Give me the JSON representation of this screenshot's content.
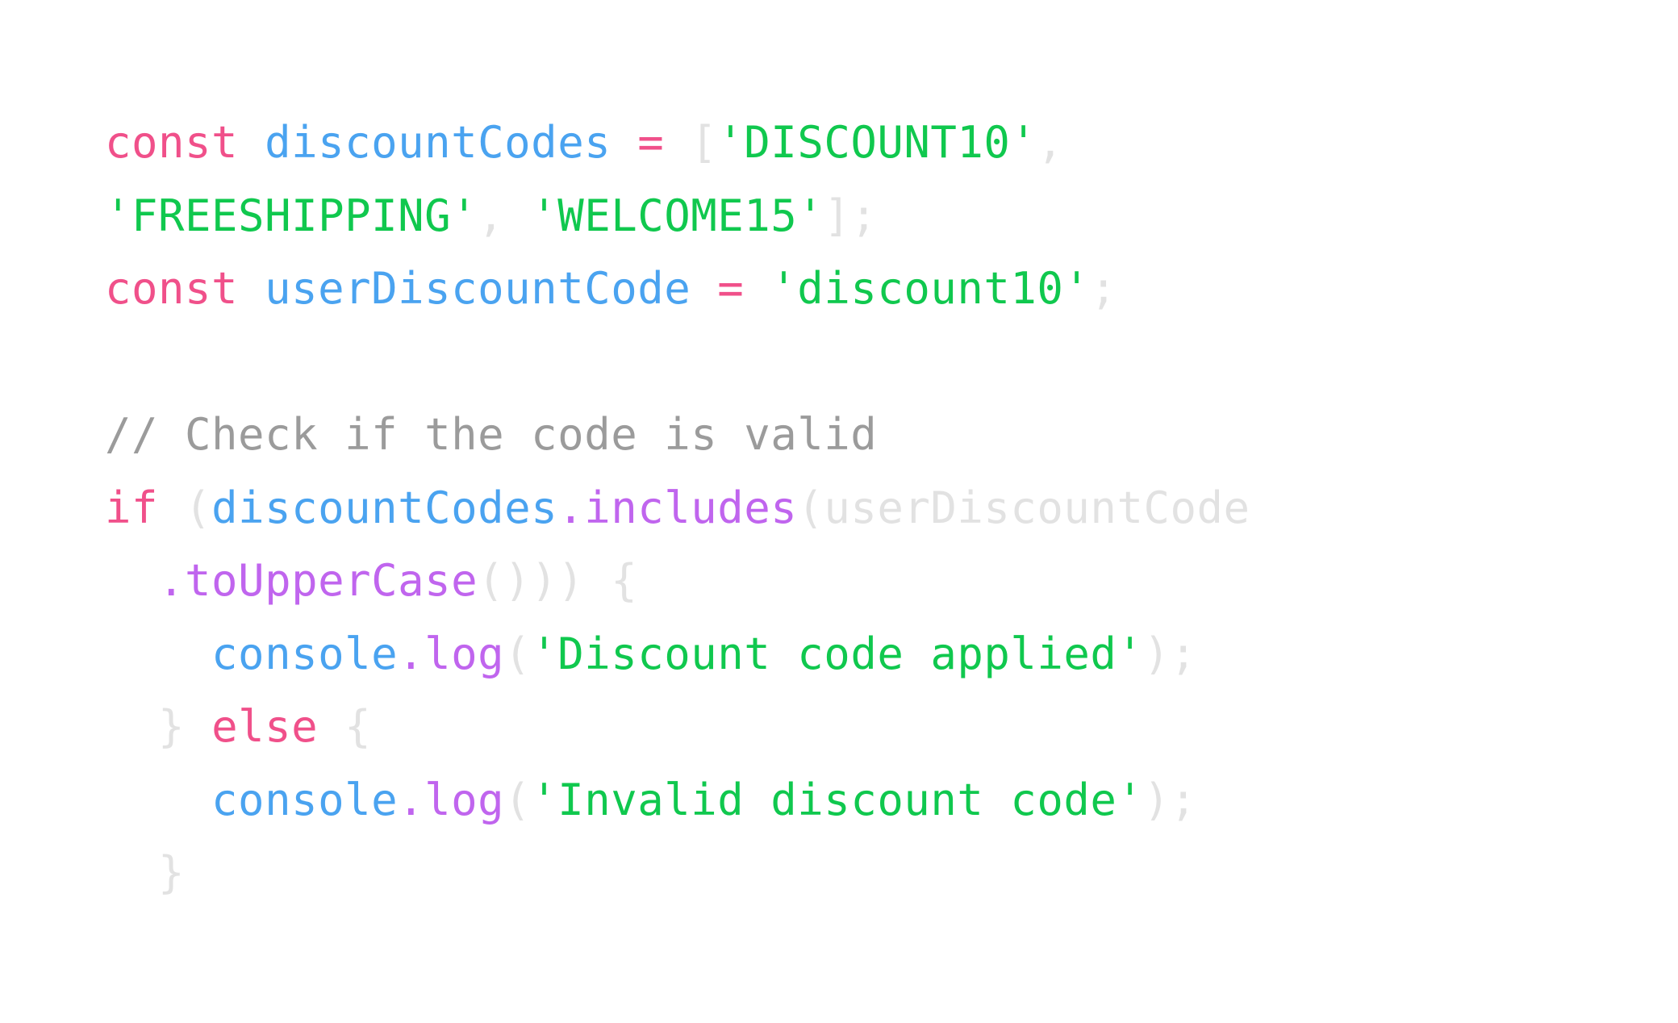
{
  "theme": {
    "keyword": "#f0508a",
    "identifier": "#4aa3f0",
    "method": "#c065ee",
    "string": "#10c84e",
    "punct": "#e2e2e2",
    "comment": "#9b9b9b",
    "background": "#ffffff"
  },
  "code": {
    "lines": [
      [
        {
          "t": "const",
          "k": "keyword"
        },
        {
          "t": " ",
          "k": "plain"
        },
        {
          "t": "discountCodes",
          "k": "identifier"
        },
        {
          "t": " ",
          "k": "plain"
        },
        {
          "t": "=",
          "k": "keyword"
        },
        {
          "t": " ",
          "k": "plain"
        },
        {
          "t": "[",
          "k": "punct"
        },
        {
          "t": "'DISCOUNT10'",
          "k": "string"
        },
        {
          "t": ",",
          "k": "punct"
        }
      ],
      [
        {
          "t": "'FREESHIPPING'",
          "k": "string"
        },
        {
          "t": ", ",
          "k": "punct"
        },
        {
          "t": "'WELCOME15'",
          "k": "string"
        },
        {
          "t": "];",
          "k": "punct"
        }
      ],
      [
        {
          "t": "const",
          "k": "keyword"
        },
        {
          "t": " ",
          "k": "plain"
        },
        {
          "t": "userDiscountCode",
          "k": "identifier"
        },
        {
          "t": " ",
          "k": "plain"
        },
        {
          "t": "=",
          "k": "keyword"
        },
        {
          "t": " ",
          "k": "plain"
        },
        {
          "t": "'discount10'",
          "k": "string"
        },
        {
          "t": ";",
          "k": "punct"
        }
      ],
      [],
      [
        {
          "t": "// Check if the code is valid",
          "k": "comment"
        }
      ],
      [
        {
          "t": "if",
          "k": "keyword"
        },
        {
          "t": " ",
          "k": "plain"
        },
        {
          "t": "(",
          "k": "punct"
        },
        {
          "t": "discountCodes",
          "k": "identifier"
        },
        {
          "t": ".includes",
          "k": "method"
        },
        {
          "t": "(userDiscountCode",
          "k": "punct"
        }
      ],
      [
        {
          "t": "  ",
          "k": "plain"
        },
        {
          "t": ".toUpperCase",
          "k": "method"
        },
        {
          "t": "())) {",
          "k": "punct"
        }
      ],
      [
        {
          "t": "    ",
          "k": "plain"
        },
        {
          "t": "console",
          "k": "identifier"
        },
        {
          "t": ".log",
          "k": "method"
        },
        {
          "t": "(",
          "k": "punct"
        },
        {
          "t": "'Discount code applied'",
          "k": "string"
        },
        {
          "t": ");",
          "k": "punct"
        }
      ],
      [
        {
          "t": "  ",
          "k": "plain"
        },
        {
          "t": "}",
          "k": "punct"
        },
        {
          "t": " ",
          "k": "plain"
        },
        {
          "t": "else",
          "k": "keyword"
        },
        {
          "t": " ",
          "k": "plain"
        },
        {
          "t": "{",
          "k": "punct"
        }
      ],
      [
        {
          "t": "    ",
          "k": "plain"
        },
        {
          "t": "console",
          "k": "identifier"
        },
        {
          "t": ".log",
          "k": "method"
        },
        {
          "t": "(",
          "k": "punct"
        },
        {
          "t": "'Invalid discount code'",
          "k": "string"
        },
        {
          "t": ");",
          "k": "punct"
        }
      ],
      [
        {
          "t": "  ",
          "k": "plain"
        },
        {
          "t": "}",
          "k": "punct"
        }
      ]
    ]
  }
}
